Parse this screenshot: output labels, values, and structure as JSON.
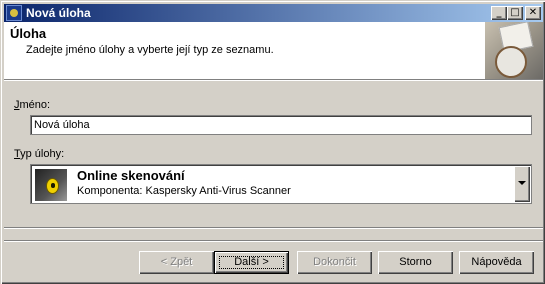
{
  "window": {
    "title": "Nová úloha",
    "minimize_label": "_",
    "maximize_label": "□",
    "close_label": "✕"
  },
  "header": {
    "title": "Úloha",
    "subtitle": "Zadejte jméno úlohy a vyberte její typ ze seznamu."
  },
  "form": {
    "name_label_access": "J",
    "name_label_rest": "méno:",
    "name_value": "Nová úloha",
    "type_label_access": "T",
    "type_label_rest": "yp úlohy:",
    "type_selected": {
      "title": "Online skenování",
      "subtitle": "Komponenta: Kaspersky Anti-Virus Scanner",
      "icon": "shield-bug-icon"
    }
  },
  "buttons": {
    "back": "< Zpět",
    "next": "Další >",
    "finish": "Dokončit",
    "cancel": "Storno",
    "help": "Nápověda"
  }
}
